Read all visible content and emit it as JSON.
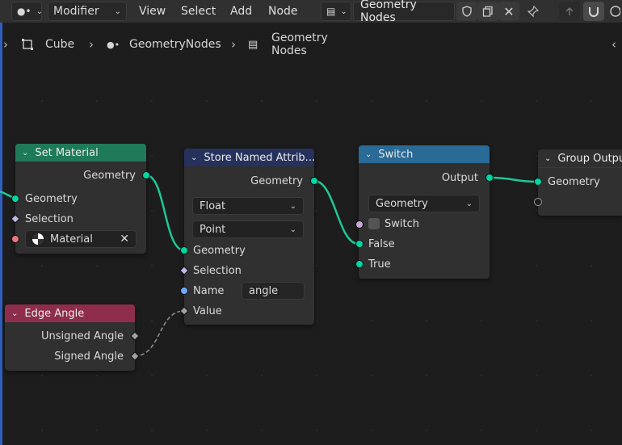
{
  "header": {
    "editor_mode": "Modifier",
    "menus": [
      "View",
      "Select",
      "Add",
      "Node"
    ],
    "tree_name": "Geometry Nodes"
  },
  "breadcrumb": {
    "items": [
      "Cube",
      "GeometryNodes",
      "Geometry Nodes"
    ]
  },
  "nodes": {
    "set_material": {
      "title": "Set Material",
      "color": "#1f7a5a",
      "output_geometry": "Geometry",
      "input_geometry": "Geometry",
      "input_selection": "Selection",
      "material_value": "Material"
    },
    "store_named": {
      "title": "Store Named Attrib...",
      "color": "#26325c",
      "output_geometry": "Geometry",
      "data_type": "Float",
      "domain": "Point",
      "input_geometry": "Geometry",
      "input_selection": "Selection",
      "input_name": "Name",
      "name_value": "angle",
      "input_value": "Value"
    },
    "switch": {
      "title": "Switch",
      "color": "#2a6a96",
      "output": "Output",
      "type": "Geometry",
      "switch_label": "Switch",
      "false_label": "False",
      "true_label": "True"
    },
    "group_output": {
      "title": "Group Outpu",
      "input_geometry": "Geometry"
    },
    "edge_angle": {
      "title": "Edge Angle",
      "color": "#8f2e4c",
      "output_unsigned": "Unsigned Angle",
      "output_signed": "Signed Angle"
    }
  },
  "colors": {
    "geometry_socket": "#00d6a3",
    "link_green": "#1ec896",
    "link_gray": "#8a8a8a"
  }
}
